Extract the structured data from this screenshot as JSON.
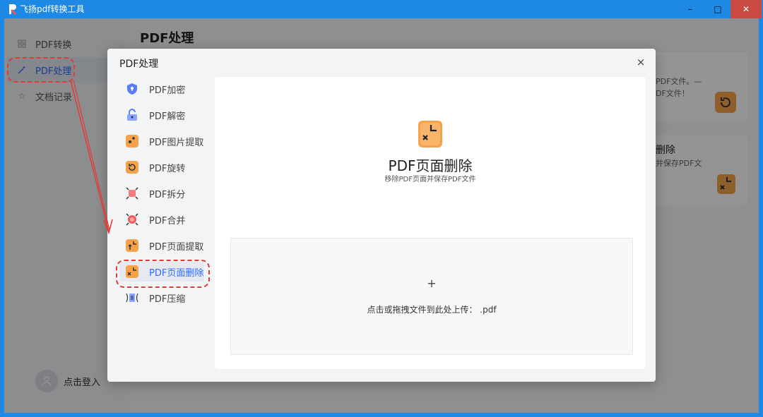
{
  "window": {
    "title": "飞扬pdf转换工具",
    "controls": {
      "minimize": "–",
      "maximize": "□",
      "close": "✕"
    }
  },
  "sidebar": {
    "items": [
      {
        "label": "PDF转换",
        "icon": "grid-icon"
      },
      {
        "label": "PDF处理",
        "icon": "magic-wand-icon"
      },
      {
        "label": "文档记录",
        "icon": "star-icon"
      }
    ],
    "login_label": "点击登入"
  },
  "main": {
    "title": "PDF处理",
    "background_cards": [
      {
        "line1": "PDF文件。—",
        "line2": "DF文件！"
      },
      {
        "title": "删除",
        "line1": "并保存PDF文"
      }
    ]
  },
  "dialog": {
    "title": "PDF处理",
    "close": "×",
    "menu": [
      {
        "label": "PDF加密",
        "icon": "shield-lock-icon",
        "color": "#5b7cf7"
      },
      {
        "label": "PDF解密",
        "icon": "unlock-icon",
        "color": "#5b7cf7"
      },
      {
        "label": "PDF图片提取",
        "icon": "image-extract-icon",
        "color": "#f5a24a"
      },
      {
        "label": "PDF旋转",
        "icon": "rotate-icon",
        "color": "#f5a24a"
      },
      {
        "label": "PDF拆分",
        "icon": "split-icon",
        "color": "#ef5a5a"
      },
      {
        "label": "PDF合并",
        "icon": "merge-icon",
        "color": "#ef5a5a"
      },
      {
        "label": "PDF页面提取",
        "icon": "page-extract-icon",
        "color": "#f5a24a"
      },
      {
        "label": "PDF页面删除",
        "icon": "page-delete-icon",
        "color": "#f5a24a",
        "active": true
      },
      {
        "label": "PDF压缩",
        "icon": "compress-icon",
        "color": "#5b7cf7"
      }
    ],
    "feature": {
      "title": "PDF页面删除",
      "subtitle": "移除PDF页面并保存PDF文件"
    },
    "dropzone": {
      "plus": "+",
      "text": "点击或拖拽文件到此处上传： .pdf"
    }
  },
  "colors": {
    "accent": "#2f6bff",
    "titlebar": "#1e88e5",
    "annotation": "#e53935"
  }
}
